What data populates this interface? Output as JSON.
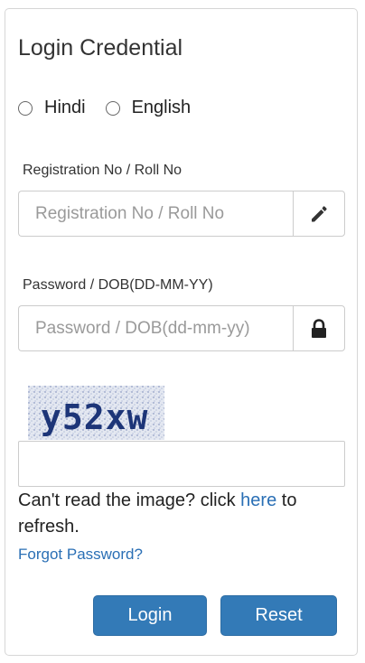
{
  "panel": {
    "title": "Login Credential"
  },
  "language": {
    "options": [
      {
        "label": "Hindi",
        "selected": false
      },
      {
        "label": "English",
        "selected": false
      }
    ]
  },
  "registration": {
    "label": "Registration No / Roll No",
    "placeholder": "Registration No / Roll No",
    "value": "",
    "icon": "pencil-icon"
  },
  "password": {
    "label": "Password / DOB(DD-MM-YY)",
    "placeholder": "Password / DOB(dd-mm-yy)",
    "value": "",
    "icon": "lock-icon"
  },
  "captcha": {
    "image_text": "y52xw",
    "input_value": "",
    "refresh_prefix": "Can't read the image? click ",
    "refresh_link": "here",
    "refresh_suffix": " to refresh."
  },
  "links": {
    "forgot_password": "Forgot Password?"
  },
  "buttons": {
    "login": "Login",
    "reset": "Reset"
  },
  "colors": {
    "primary": "#337ab7",
    "link": "#2a6fb5",
    "border": "#cccccc"
  }
}
